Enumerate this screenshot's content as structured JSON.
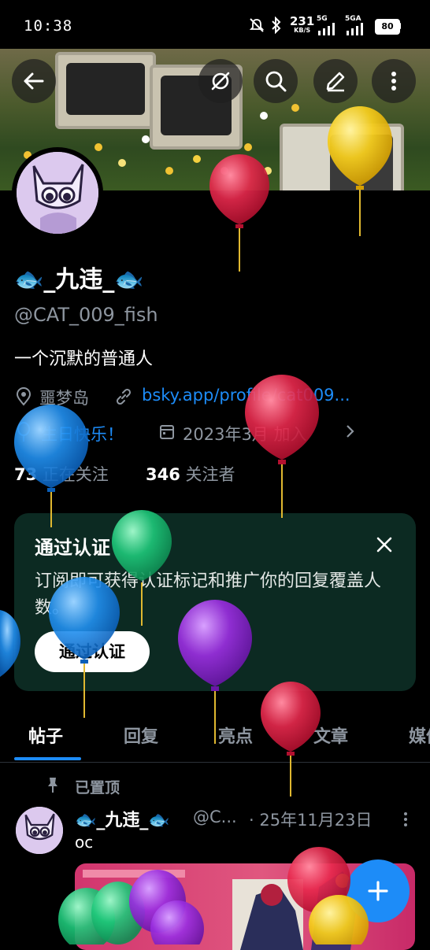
{
  "status_bar": {
    "time": "10:38",
    "speed_value": "231",
    "speed_unit": "KB/S",
    "net1": "5G",
    "net2": "5GA",
    "battery": "80"
  },
  "profile": {
    "name": "🐟_九违_🐟",
    "handle": "@CAT_009_fish",
    "bio": "一个沉默的普通人",
    "location": "噩梦岛",
    "link": "bsky.app/profile/cat009...",
    "birthday": "生日快乐！",
    "joined": "2023年3月 加入",
    "following_count": "73",
    "following_label": "正在关注",
    "followers_count": "346",
    "followers_label": "关注者"
  },
  "verify_card": {
    "title": "通过认证",
    "body": "订阅即可获得认证标记和推广你的回复覆盖人数。",
    "button": "通过认证"
  },
  "tabs": [
    "帖子",
    "回复",
    "亮点",
    "文章",
    "媒体"
  ],
  "post": {
    "pinned_label": "已置顶",
    "author_name": "🐟_九违_🐟",
    "author_handle": "@C...",
    "time": "· 25年11月23日",
    "text": "oc"
  },
  "colors": {
    "accent": "#1d8cf8",
    "card_bg": "#0c2a22",
    "muted": "#8e96a0"
  },
  "icons": {
    "header": [
      "back-arrow-icon",
      "share-off-icon",
      "search-icon",
      "edit-icon",
      "more-vertical-icon"
    ],
    "fab": "plus-icon"
  }
}
